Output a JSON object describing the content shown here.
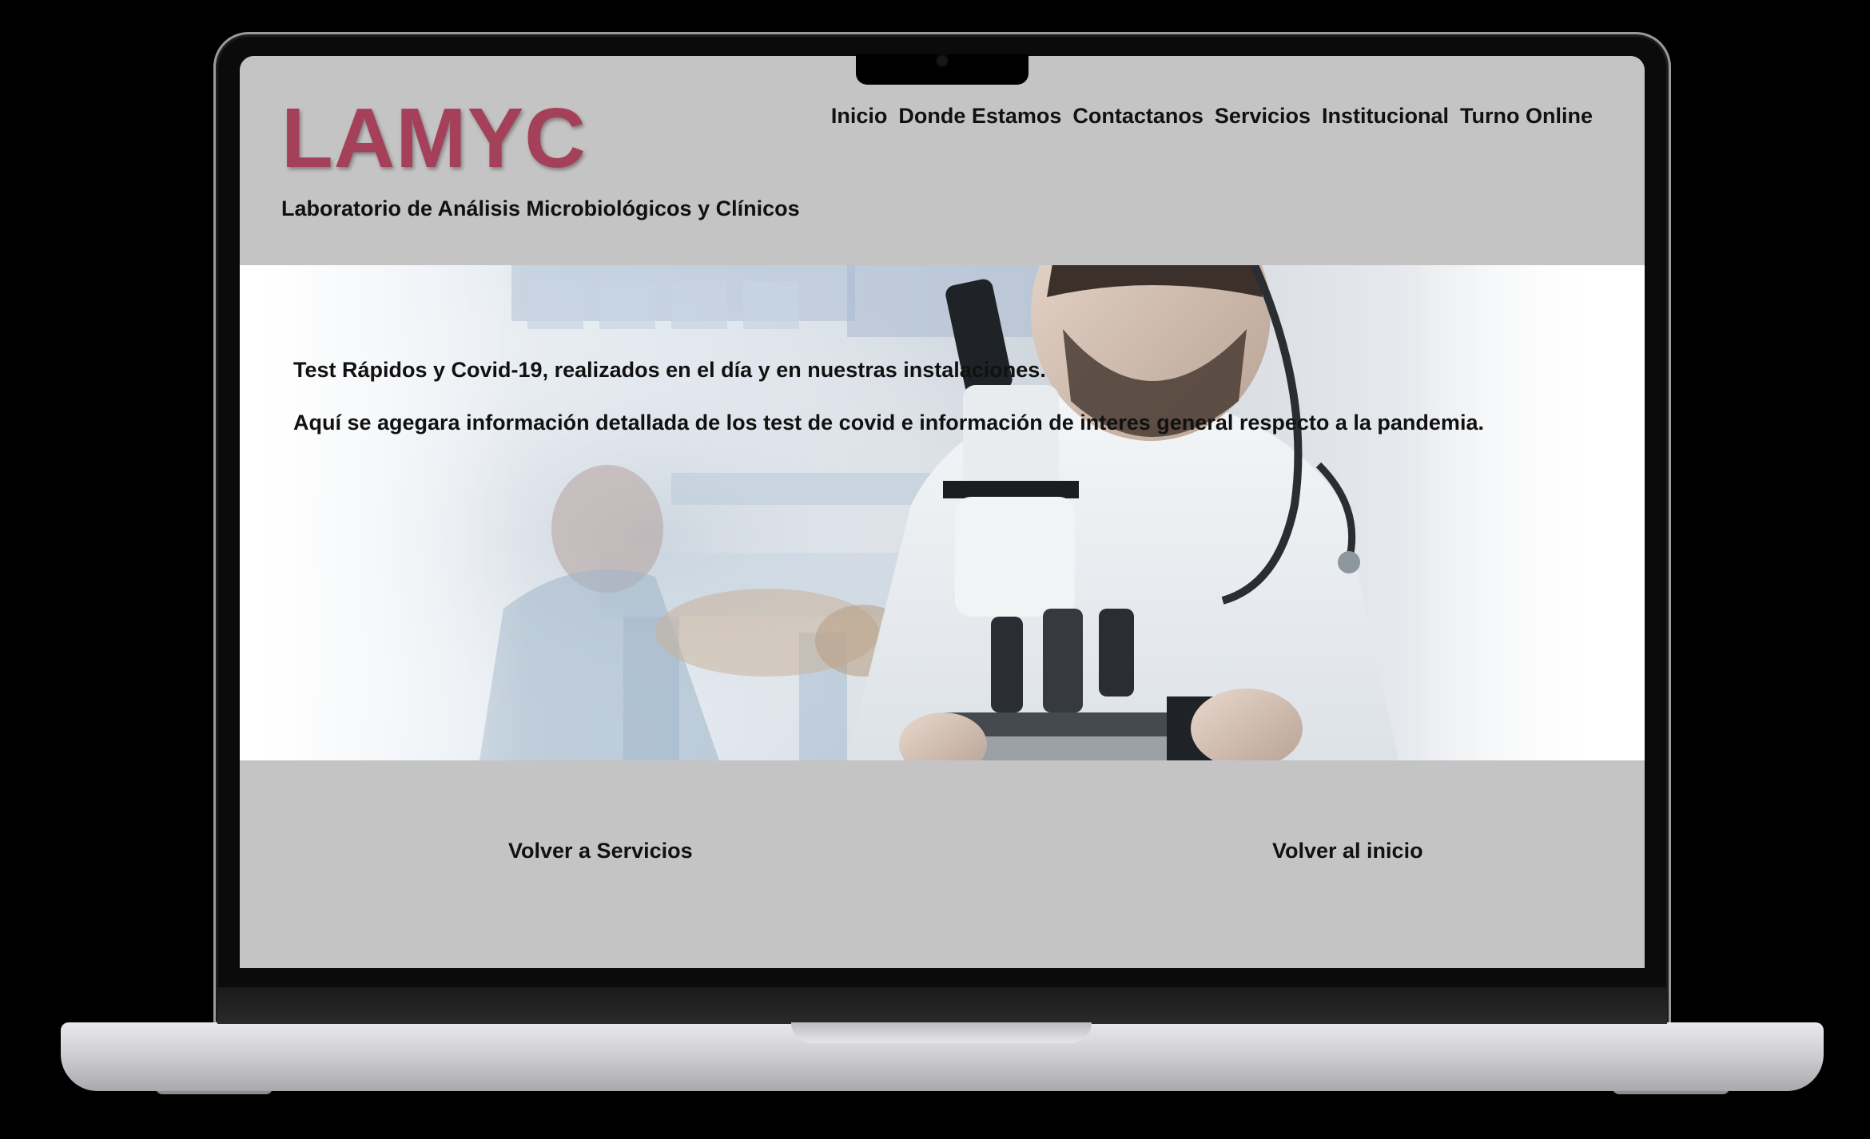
{
  "site": {
    "logo_text": "LAMYC",
    "tagline": "Laboratorio de Análisis Microbiológicos y Clínicos",
    "brand_color": "#a5405a",
    "nav": [
      "Inicio",
      "Donde Estamos",
      "Contactanos",
      "Servicios",
      "Institucional",
      "Turno Online"
    ]
  },
  "hero": {
    "line1": "Test Rápidos y Covid-19, realizados en el día y en nuestras instalaciones.",
    "line2": "Aquí se agegara información detallada de los test de covid e información de interes general respecto a la pandemia.",
    "image": "laboratory-microscope-photo"
  },
  "footer": {
    "link_services": "Volver a Servicios",
    "link_home": "Volver al inicio"
  },
  "device": {
    "frame": "laptop-mockup",
    "body_color": "#d0d0d4"
  }
}
